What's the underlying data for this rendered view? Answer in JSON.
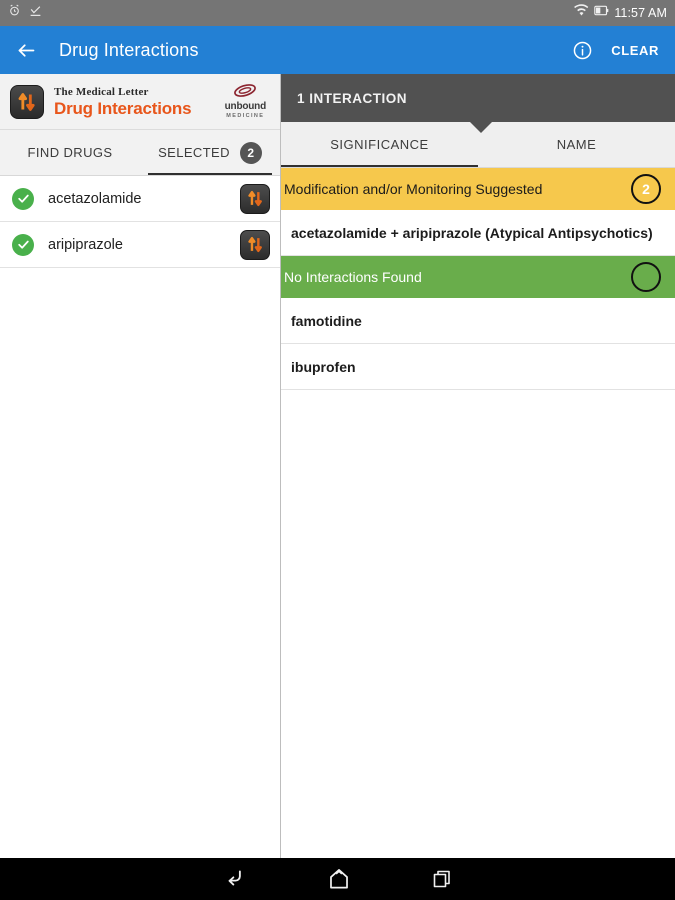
{
  "status_bar": {
    "icons": [
      "alarm-icon",
      "download-complete-icon",
      "wifi-icon",
      "battery-icon"
    ],
    "time": "11:57 AM"
  },
  "app_bar": {
    "back_icon": "back-arrow-icon",
    "title": "Drug Interactions",
    "info_icon": "info-icon",
    "clear_label": "CLEAR",
    "background": "#2380d4"
  },
  "left_pane": {
    "brand": {
      "icon": "drug-interactions-app-icon",
      "line1": "The Medical Letter",
      "line2": "Drug Interactions",
      "publisher_name": "unbound",
      "publisher_sub": "MEDICINE",
      "accent": "#e8561b"
    },
    "tabs": [
      {
        "label": "FIND DRUGS",
        "active": false,
        "badge": null
      },
      {
        "label": "SELECTED",
        "active": true,
        "badge": "2"
      }
    ],
    "selected_drugs": [
      {
        "name": "acetazolamide",
        "checked": true,
        "action_icon": "drug-interactions-icon"
      },
      {
        "name": "aripiprazole",
        "checked": true,
        "action_icon": "drug-interactions-icon"
      }
    ]
  },
  "right_pane": {
    "header_title": "1 INTERACTION",
    "tabs": [
      {
        "label": "SIGNIFICANCE",
        "active": true
      },
      {
        "label": "NAME",
        "active": false
      }
    ],
    "sections": [
      {
        "label": "Modification and/or Monitoring Suggested",
        "badge": "2",
        "severity": "warning",
        "color": "#f6c84c",
        "items": [
          {
            "text": "acetazolamide + aripiprazole (Atypical Antipsychotics)"
          }
        ]
      },
      {
        "label": "No Interactions Found",
        "badge": "",
        "severity": "none",
        "color": "#69ad4b",
        "items": [
          {
            "text": "famotidine"
          },
          {
            "text": "ibuprofen"
          }
        ]
      }
    ]
  },
  "nav_bar": {
    "buttons": [
      {
        "icon": "back-nav-icon",
        "label": "Back"
      },
      {
        "icon": "home-nav-icon",
        "label": "Home"
      },
      {
        "icon": "recents-nav-icon",
        "label": "Recents"
      }
    ]
  }
}
